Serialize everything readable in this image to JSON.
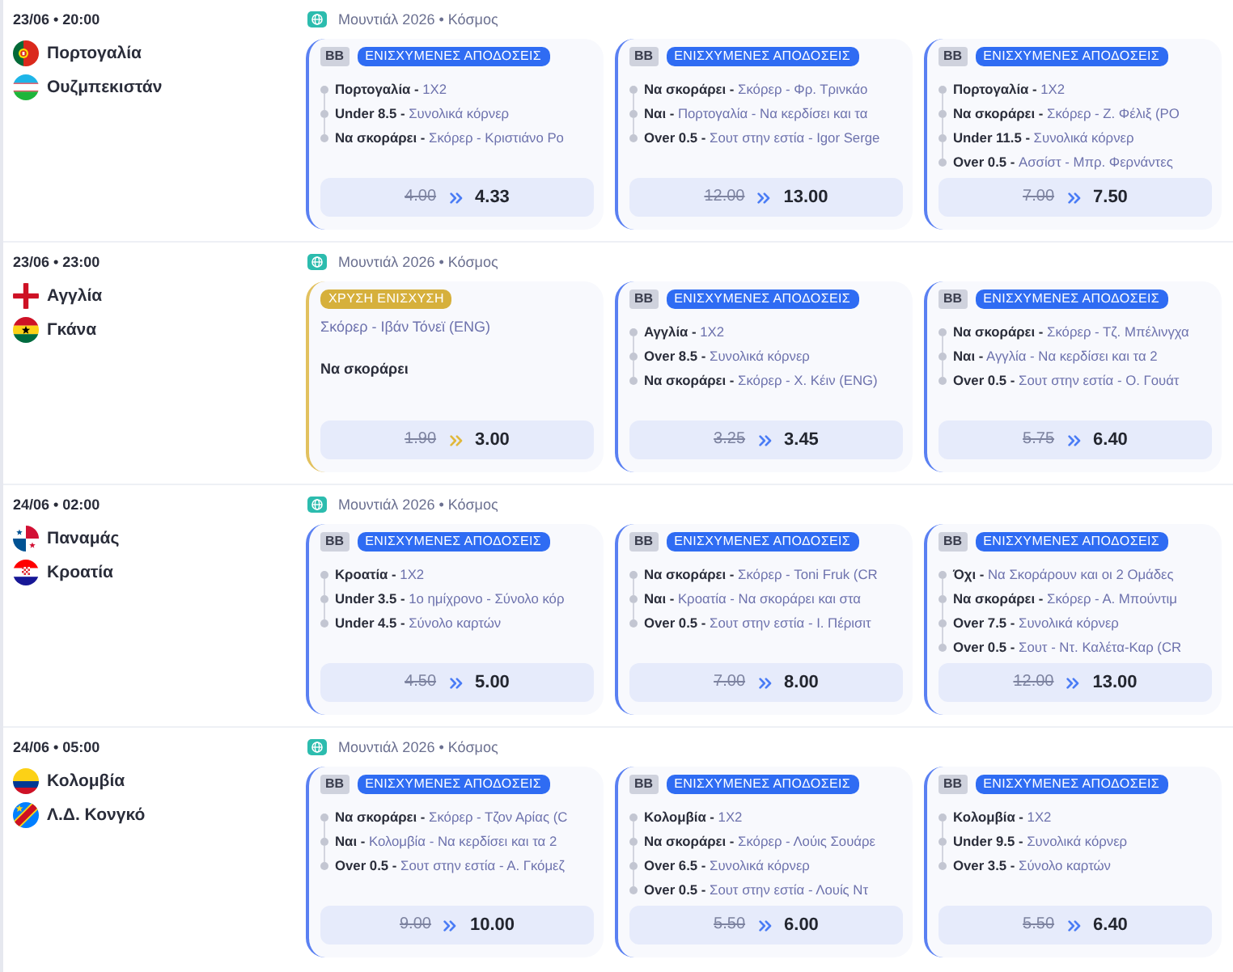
{
  "matches": [
    {
      "time": "23/06 • 20:00",
      "teams": [
        {
          "name": "Πορτογαλία",
          "kind": "portugal"
        },
        {
          "name": "Ουζμπεκιστάν",
          "kind": "uzbekistan"
        }
      ],
      "competition": "Μουντιάλ 2026 • Κόσμος",
      "offers": [
        {
          "kind": "builder",
          "code": "BB",
          "tag": "ΕΝΙΣΧΥΜΕΝΕΣ ΑΠΟΔΟΣΕΙΣ",
          "legs": [
            "**Πορτογαλία -** 1X2",
            "**Under 8.5 -** Συνολικά κόρνερ",
            "**Να σκοράρει -** Σκόρερ - Κριστιάνο Ρο"
          ],
          "old_odds": "4.00",
          "new_odds": "4.33"
        },
        {
          "kind": "builder",
          "code": "BB",
          "tag": "ΕΝΙΣΧΥΜΕΝΕΣ ΑΠΟΔΟΣΕΙΣ",
          "legs": [
            "**Να σκοράρει -** Σκόρερ - Φρ. Τρινκάο",
            "**Ναι -** Πορτογαλία - Να κερδίσει και τα",
            "**Over 0.5 -** Σουτ στην εστία - Igor Serge"
          ],
          "old_odds": "12.00",
          "new_odds": "13.00"
        },
        {
          "kind": "builder",
          "code": "BB",
          "tag": "ΕΝΙΣΧΥΜΕΝΕΣ ΑΠΟΔΟΣΕΙΣ",
          "legs": [
            "**Πορτογαλία -** 1X2",
            "**Να σκοράρει -** Σκόρερ - Ζ. Φέλιξ (PO",
            "**Under 11.5 -** Συνολικά κόρνερ",
            "**Over 0.5 -** Ασσίστ - Μπρ. Φερνάντες"
          ],
          "old_odds": "7.00",
          "new_odds": "7.50"
        }
      ]
    },
    {
      "time": "23/06 • 23:00",
      "teams": [
        {
          "name": "Αγγλία",
          "kind": "england"
        },
        {
          "name": "Γκάνα",
          "kind": "ghana"
        }
      ],
      "competition": "Μουντιάλ 2026 • Κόσμος",
      "offers": [
        {
          "kind": "gold",
          "tag": "ΧΡΥΣΗ ΕΝΙΣΧΥΣΗ",
          "market": "Σκόρερ - Ιβάν Τόνεϊ (ENG)",
          "pick": "Να σκοράρει",
          "old_odds": "1.90",
          "new_odds": "3.00"
        },
        {
          "kind": "builder",
          "code": "BB",
          "tag": "ΕΝΙΣΧΥΜΕΝΕΣ ΑΠΟΔΟΣΕΙΣ",
          "legs": [
            "**Αγγλία -** 1X2",
            "**Over 8.5 -** Συνολικά κόρνερ",
            "**Να σκοράρει -** Σκόρερ - Χ. Κέιν (ENG)"
          ],
          "old_odds": "3.25",
          "new_odds": "3.45"
        },
        {
          "kind": "builder",
          "code": "BB",
          "tag": "ΕΝΙΣΧΥΜΕΝΕΣ ΑΠΟΔΟΣΕΙΣ",
          "legs": [
            "**Να σκοράρει -** Σκόρερ - Τζ. Μπέλινγχα",
            "**Ναι -** Αγγλία - Να κερδίσει και τα 2",
            "**Over 0.5 -** Σουτ στην εστία - Ο. Γουάτ"
          ],
          "old_odds": "5.75",
          "new_odds": "6.40"
        }
      ]
    },
    {
      "time": "24/06 • 02:00",
      "teams": [
        {
          "name": "Παναμάς",
          "kind": "panama"
        },
        {
          "name": "Κροατία",
          "kind": "croatia"
        }
      ],
      "competition": "Μουντιάλ 2026 • Κόσμος",
      "offers": [
        {
          "kind": "builder",
          "code": "BB",
          "tag": "ΕΝΙΣΧΥΜΕΝΕΣ ΑΠΟΔΟΣΕΙΣ",
          "legs": [
            "**Κροατία -** 1X2",
            "**Under 3.5 -** 1ο ημίχρονο - Σύνολο κόρ",
            "**Under 4.5 -** Σύνολο καρτών"
          ],
          "old_odds": "4.50",
          "new_odds": "5.00"
        },
        {
          "kind": "builder",
          "code": "BB",
          "tag": "ΕΝΙΣΧΥΜΕΝΕΣ ΑΠΟΔΟΣΕΙΣ",
          "legs": [
            "**Να σκοράρει -** Σκόρερ - Toni Fruk (CR",
            "**Ναι -** Κροατία - Να σκοράρει και στα",
            "**Over 0.5 -** Σουτ στην εστία - Ι. Πέρισιτ"
          ],
          "old_odds": "7.00",
          "new_odds": "8.00"
        },
        {
          "kind": "builder",
          "code": "BB",
          "tag": "ΕΝΙΣΧΥΜΕΝΕΣ ΑΠΟΔΟΣΕΙΣ",
          "legs": [
            "**Όχι -** Να Σκοράρουν και οι 2 Ομάδες",
            "**Να σκοράρει -** Σκόρερ - Α. Μπούντιμ",
            "**Over 7.5 -** Συνολικά κόρνερ",
            "**Over 0.5 -** Σουτ - Ντ. Καλέτα-Καρ (CR"
          ],
          "old_odds": "12.00",
          "new_odds": "13.00"
        }
      ]
    },
    {
      "time": "24/06 • 05:00",
      "teams": [
        {
          "name": "Κολομβία",
          "kind": "colombia"
        },
        {
          "name": "Λ.Δ. Κονγκό",
          "kind": "drcongo"
        }
      ],
      "competition": "Μουντιάλ 2026 • Κόσμος",
      "offers": [
        {
          "kind": "builder",
          "code": "BB",
          "tag": "ΕΝΙΣΧΥΜΕΝΕΣ ΑΠΟΔΟΣΕΙΣ",
          "legs": [
            "**Να σκοράρει -** Σκόρερ - Τζον Αρίας (C",
            "**Ναι -** Κολομβία - Να κερδίσει και τα 2",
            "**Over 0.5 -** Σουτ στην εστία - Α. Γκόμεζ"
          ],
          "old_odds": "9.00",
          "new_odds": "10.00"
        },
        {
          "kind": "builder",
          "code": "BB",
          "tag": "ΕΝΙΣΧΥΜΕΝΕΣ ΑΠΟΔΟΣΕΙΣ",
          "legs": [
            "**Κολομβία -** 1X2",
            "**Να σκοράρει -** Σκόρερ - Λούις Σουάρε",
            "**Over 6.5 -** Συνολικά κόρνερ",
            "**Over 0.5 -** Σουτ στην εστία - Λουίς Ντ"
          ],
          "old_odds": "5.50",
          "new_odds": "6.00"
        },
        {
          "kind": "builder",
          "code": "BB",
          "tag": "ΕΝΙΣΧΥΜΕΝΕΣ ΑΠΟΔΟΣΕΙΣ",
          "legs": [
            "**Κολομβία -** 1X2",
            "**Under 9.5 -** Συνολικά κόρνερ",
            "**Over 3.5 -** Σύνολο καρτών"
          ],
          "old_odds": "5.50",
          "new_odds": "6.40"
        }
      ]
    }
  ]
}
